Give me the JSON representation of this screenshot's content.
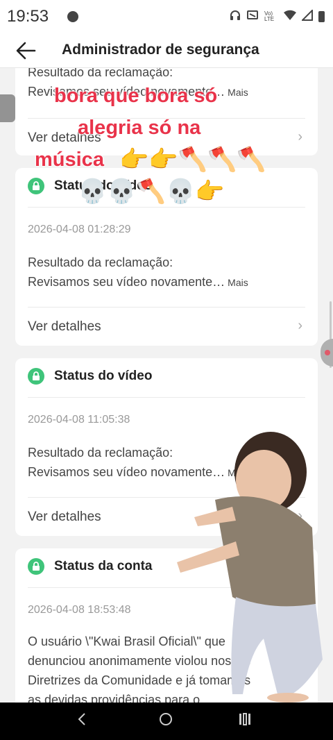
{
  "status_bar": {
    "time": "19:53",
    "icons": [
      "headphones-icon",
      "cast-icon",
      "volte-icon",
      "wifi-icon",
      "signal-icon",
      "battery-icon"
    ],
    "volte_label": "Vo) LTE"
  },
  "app_bar": {
    "title": "Administrador de segurança"
  },
  "cards": [
    {
      "result_label": "Resultado da reclamação:",
      "result_text": "Revisamos seu vídeo novamente…",
      "more": "Mais",
      "details": "Ver detalhes"
    },
    {
      "header": "Status do vídeo",
      "date": "2026-04-08 01:28:29",
      "result_label": "Resultado da reclamação:",
      "result_text": "Revisamos seu vídeo novamente…",
      "more": "Mais",
      "details": "Ver detalhes"
    },
    {
      "header": "Status do vídeo",
      "date": "2026-04-08 11:05:38",
      "result_label": "Resultado da reclamação:",
      "result_text": "Revisamos seu vídeo novamente…",
      "more": "Mais",
      "details": "Ver detalhes"
    },
    {
      "header": "Status da conta",
      "date": "2026-04-08 18:53:48",
      "body_lines": [
        "O usuário \\\"Kwai Brasil Oficial\\\" que",
        "denunciou anonimamente violou nossas",
        "Diretrizes da Comunidade e já tomamos",
        "as devidas providências para o..."
      ]
    }
  ],
  "overlay": {
    "line1": "bora que bora só",
    "line2": "alegria só na",
    "line3": "música",
    "emojis_row1": "👉👉🪓🪓🪓",
    "emojis_row2": "💀💀🪓💀👉"
  },
  "colors": {
    "accent_green": "#3fc47a",
    "overlay_red": "#e9334a"
  }
}
